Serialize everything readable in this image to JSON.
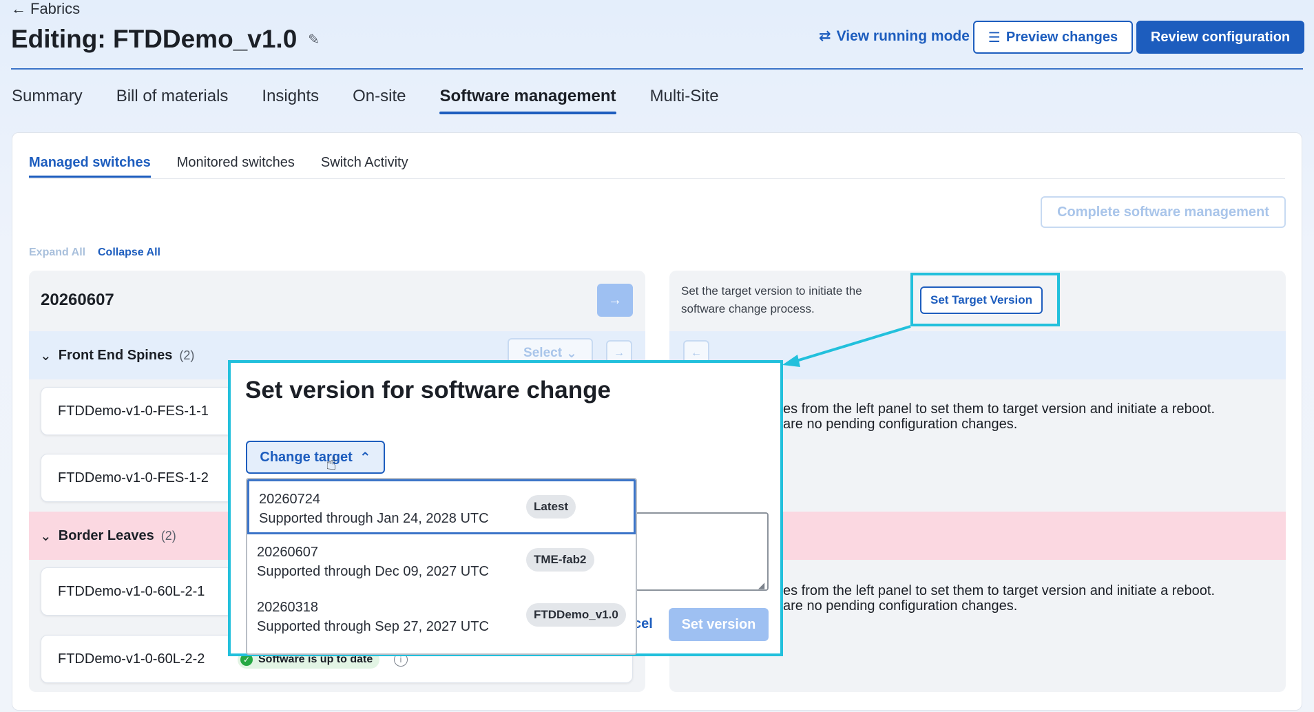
{
  "header": {
    "back_label": "Fabrics",
    "title": "Editing: FTDDemo_v1.0",
    "view_running_label": "View running mode",
    "preview_label": "Preview changes",
    "review_label": "Review configuration"
  },
  "tabs": [
    {
      "label": "Summary"
    },
    {
      "label": "Bill of materials"
    },
    {
      "label": "Insights"
    },
    {
      "label": "On-site"
    },
    {
      "label": "Software management",
      "active": true
    },
    {
      "label": "Multi-Site"
    }
  ],
  "subtabs": [
    {
      "label": "Managed switches",
      "active": true
    },
    {
      "label": "Monitored switches"
    },
    {
      "label": "Switch Activity"
    }
  ],
  "toolbar": {
    "complete_label": "Complete software management",
    "expand_all": "Expand All",
    "collapse_all": "Collapse All"
  },
  "left_panel": {
    "version": "20260607",
    "select_label": "Select",
    "groups": [
      {
        "name": "Front End Spines",
        "count": "(2)",
        "switches": [
          "FTDDemo-v1-0-FES-1-1",
          "FTDDemo-v1-0-FES-1-2"
        ]
      },
      {
        "name": "Border Leaves",
        "count": "(2)",
        "switches": [
          "FTDDemo-v1-0-60L-2-1",
          "FTDDemo-v1-0-60L-2-2"
        ]
      }
    ],
    "status_badge": "Software is up to date"
  },
  "right_panel": {
    "hint": "Set the target version to initiate the software change process.",
    "set_target_label": "Set Target Version",
    "message_line1": "es from the left panel to set them to target version and initiate a reboot.",
    "message_line2": "are no pending configuration changes."
  },
  "modal": {
    "title": "Set version for software change",
    "change_target_label": "Change target",
    "cancel_fragment": "cel",
    "set_version_label": "Set version",
    "options": [
      {
        "version": "20260724",
        "support": "Supported through Jan 24, 2028 UTC",
        "tag": "Latest",
        "selected": true
      },
      {
        "version": "20260607",
        "support": "Supported through Dec 09, 2027 UTC",
        "tag": "TME-fab2"
      },
      {
        "version": "20260318",
        "support": "Supported through Sep 27, 2027 UTC",
        "tag": "FTDDemo_v1.0"
      }
    ]
  },
  "colors": {
    "accent": "#1d5dbe",
    "highlight": "#22c0dc",
    "group_blue": "#e4eefb",
    "group_pink": "#fbd8e1"
  }
}
